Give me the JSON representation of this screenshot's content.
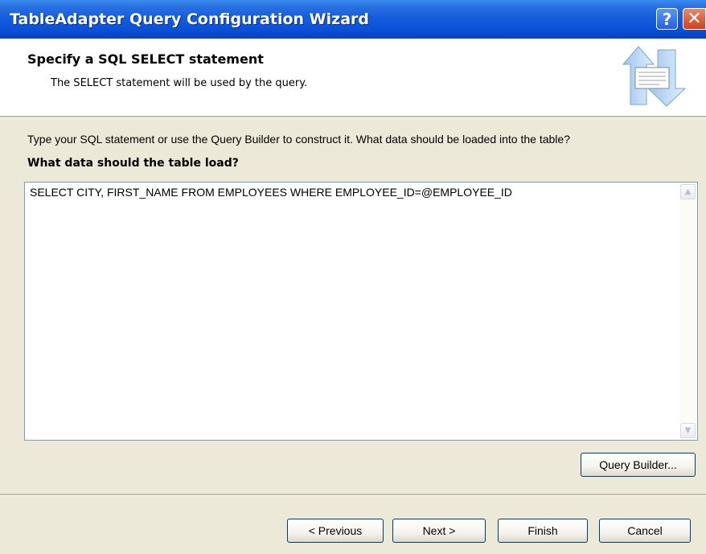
{
  "window": {
    "title": "TableAdapter Query Configuration Wizard"
  },
  "titlebar": {
    "help_label": "?",
    "close_label": "✕"
  },
  "header": {
    "title": "Specify a SQL SELECT statement",
    "subtitle": "The SELECT statement will be used by the query.",
    "icon": "wizard-data-icon"
  },
  "content": {
    "instruction": "Type your SQL statement or use the Query Builder to construct it. What data should be loaded into the table?",
    "prompt": "What data should the table load?",
    "sql": "SELECT  CITY, FIRST_NAME FROM EMPLOYEES WHERE EMPLOYEE_ID=@EMPLOYEE_ID",
    "query_builder_label": "Query Builder..."
  },
  "footer": {
    "previous_label": "< Previous",
    "next_label": "Next >",
    "finish_label": "Finish",
    "cancel_label": "Cancel"
  },
  "colors": {
    "titlebar": "#0a4fd6",
    "dialog_bg": "#ECE9D8",
    "button_border": "#003c74",
    "textbox_border": "#7f9db9"
  }
}
